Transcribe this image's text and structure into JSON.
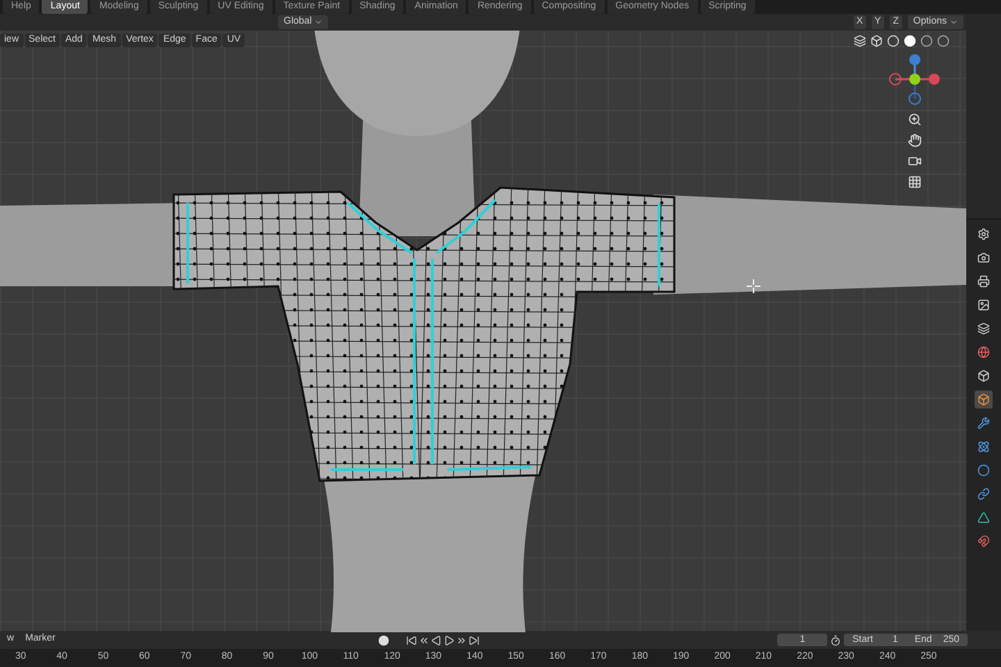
{
  "workspace_tabs": [
    {
      "label": "Help",
      "selected": false
    },
    {
      "label": "Layout",
      "selected": true
    },
    {
      "label": "Modeling",
      "selected": false
    },
    {
      "label": "Sculpting",
      "selected": false
    },
    {
      "label": "UV Editing",
      "selected": false
    },
    {
      "label": "Texture Paint",
      "selected": false
    },
    {
      "label": "Shading",
      "selected": false
    },
    {
      "label": "Animation",
      "selected": false
    },
    {
      "label": "Rendering",
      "selected": false
    },
    {
      "label": "Compositing",
      "selected": false
    },
    {
      "label": "Geometry Nodes",
      "selected": false
    },
    {
      "label": "Scripting",
      "selected": false
    }
  ],
  "header": {
    "orientation": "Global",
    "axes": [
      "X",
      "Y",
      "Z"
    ],
    "options": "Options"
  },
  "viewport_menu": [
    "iew",
    "Select",
    "Add",
    "Mesh",
    "Vertex",
    "Edge",
    "Face",
    "UV"
  ],
  "properties_tabs": [
    {
      "selected": false
    },
    {
      "selected": false
    },
    {
      "selected": false
    },
    {
      "selected": false
    },
    {
      "selected": false
    },
    {
      "selected": false
    },
    {
      "selected": false
    },
    {
      "selected": true
    },
    {
      "selected": false
    },
    {
      "selected": false
    },
    {
      "selected": false
    },
    {
      "selected": false
    },
    {
      "selected": false
    },
    {
      "selected": false
    }
  ],
  "timeline": {
    "menu": [
      "w",
      "Marker"
    ],
    "current_frame": "1",
    "start_label": "Start",
    "start": "1",
    "end_label": "End",
    "end": "250",
    "ruler": [
      "30",
      "40",
      "50",
      "60",
      "70",
      "80",
      "90",
      "100",
      "110",
      "120",
      "130",
      "140",
      "150",
      "160",
      "170",
      "180",
      "190",
      "200",
      "210",
      "220",
      "230",
      "240",
      "250"
    ]
  }
}
